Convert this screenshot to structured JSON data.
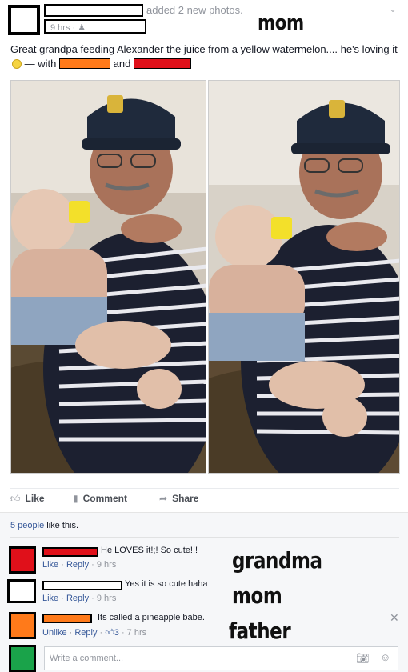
{
  "post": {
    "action_text": "added 2 new photos.",
    "time": "9 hrs",
    "audience_icon": "friends-icon",
    "annotation_author": "mom",
    "caption_text": "Great grandpa feeding Alexander the juice from a yellow watermelon.... he's loving it",
    "caption_with": "— with",
    "caption_and": "and"
  },
  "actions": {
    "like": "Like",
    "comment": "Comment",
    "share": "Share"
  },
  "likes_summary": {
    "count_link": "5 people",
    "suffix": "like this."
  },
  "comments": [
    {
      "text": "He LOVES it!;! So cute!!!",
      "like": "Like",
      "reply": "Reply",
      "time": "9 hrs",
      "annotation": "grandma",
      "color": "#e0101a"
    },
    {
      "text": "Yes it is so cute haha",
      "like": "Like",
      "reply": "Reply",
      "time": "9 hrs",
      "annotation": "mom",
      "color": "#ffffff"
    },
    {
      "text": "Its called a pineapple babe.",
      "like": "Unlike",
      "reply": "Reply",
      "like_count": "3",
      "time": "7 hrs",
      "annotation": "father",
      "color": "#ff7a1a"
    }
  ],
  "composer": {
    "placeholder": "Write a comment...",
    "annotation_color": "#1aa34a"
  },
  "colors": {
    "link": "#365899",
    "meta": "#90949c",
    "redact_red": "#e0101a",
    "redact_orange": "#ff7a1a",
    "redact_green": "#1aa34a"
  }
}
